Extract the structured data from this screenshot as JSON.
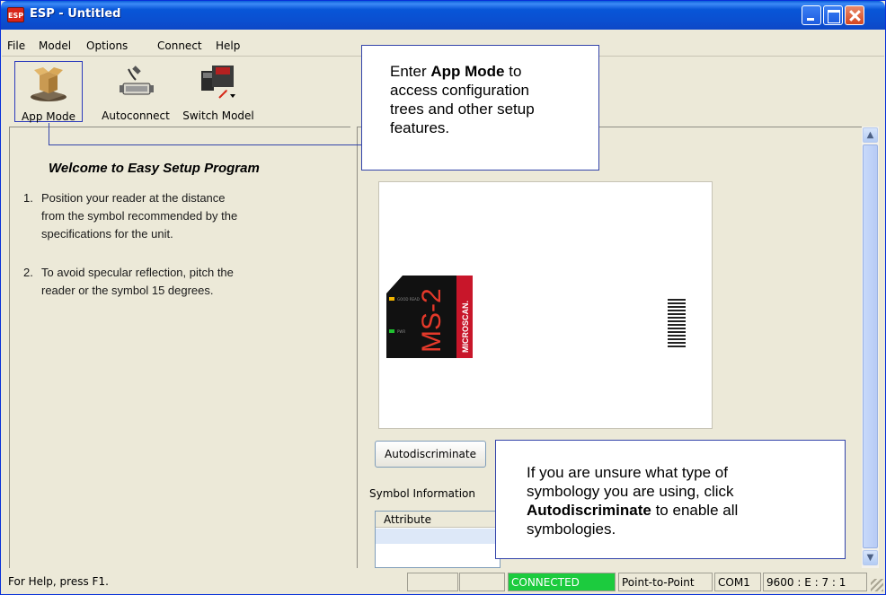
{
  "window": {
    "title": "ESP - Untitled",
    "app_icon_text": "ESP"
  },
  "menu": [
    "File",
    "Model",
    "Options",
    "Connect",
    "Help"
  ],
  "toolbar": {
    "app_mode": "App Mode",
    "autoconnect": "Autoconnect",
    "switch_model": "Switch Model"
  },
  "left_panel": {
    "heading": "Welcome to Easy Setup Program",
    "steps": [
      {
        "num": "1.",
        "line1": "Position your reader at the distance",
        "line2": "from the symbol recommended by the",
        "line3": "specifications for the unit."
      },
      {
        "num": "2.",
        "line1": "To avoid specular reflection, pitch the",
        "line2": "reader or the symbol 15 degrees."
      }
    ]
  },
  "right_panel": {
    "reader_label": "MS-2",
    "reader_brand": "MICROSCAN.",
    "autodiscriminate_label": "Autodiscriminate",
    "symbol_info_label": "Symbol Information",
    "table_header": "Attribute"
  },
  "callouts": {
    "app_mode": {
      "pre": "Enter ",
      "bold": "App Mode",
      "post_line1": " to",
      "line2": "access configuration",
      "line3": "trees and other setup",
      "line4": "features."
    },
    "autodiscriminate": {
      "line1": "If you are unsure what type of",
      "line2": "symbology you are using, click",
      "bold": "Autodiscriminate",
      "post_line3": " to enable all",
      "line4": "symbologies."
    }
  },
  "status": {
    "help": "For Help, press F1.",
    "connected": "CONNECTED",
    "mode": "Point-to-Point",
    "port": "COM1",
    "settings": "9600 : E : 7 : 1",
    "connected_color": "#1ccb3e"
  }
}
